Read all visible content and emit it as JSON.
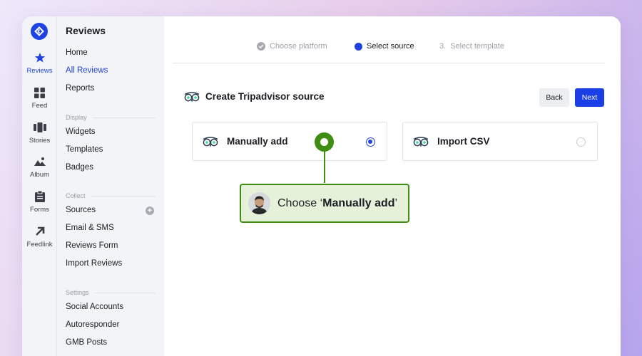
{
  "rail": {
    "items": [
      {
        "label": "Reviews",
        "icon": "star-icon",
        "active": true
      },
      {
        "label": "Feed",
        "icon": "grid-icon"
      },
      {
        "label": "Stories",
        "icon": "stories-icon"
      },
      {
        "label": "Album",
        "icon": "image-icon"
      },
      {
        "label": "Forms",
        "icon": "clipboard-icon"
      },
      {
        "label": "Feedlink",
        "icon": "arrow-up-right-icon"
      }
    ]
  },
  "nav": {
    "title": "Reviews",
    "items_top": [
      "Home",
      "All Reviews",
      "Reports"
    ],
    "section_display": "Display",
    "items_display": [
      "Widgets",
      "Templates",
      "Badges"
    ],
    "section_collect": "Collect",
    "items_collect": [
      "Sources",
      "Email & SMS",
      "Reviews Form",
      "Import Reviews"
    ],
    "section_settings": "Settings",
    "items_settings": [
      "Social Accounts",
      "Autoresponder",
      "GMB Posts"
    ]
  },
  "stepper": {
    "step1": "Choose platform",
    "step2": "Select source",
    "step3_num": "3.",
    "step3": "Select template"
  },
  "main": {
    "title": "Create Tripadvisor source",
    "back_label": "Back",
    "next_label": "Next",
    "option1": "Manually add",
    "option2": "Import CSV",
    "selected_option": "Manually add"
  },
  "callout": {
    "prefix": "Choose ‘",
    "bold": "Manually add",
    "suffix": "’"
  },
  "colors": {
    "accent": "#1f43e0",
    "callout_green": "#3f8e12",
    "callout_bg": "#e6f1da"
  }
}
